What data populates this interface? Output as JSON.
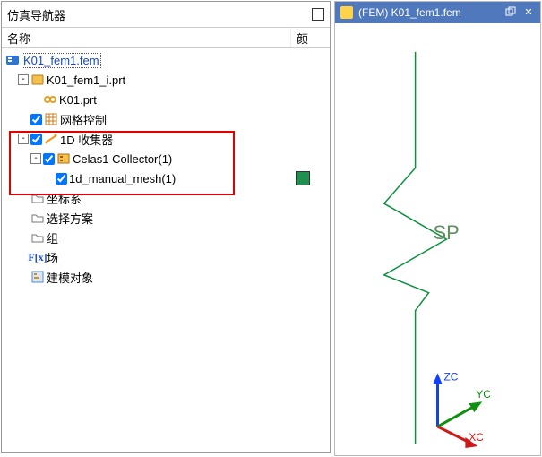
{
  "panelTitle": "仿真导航器",
  "colName": "名称",
  "colColor": "颜",
  "tree": {
    "root": "K01_fem1.fem",
    "prt_i": "K01_fem1_i.prt",
    "prt": "K01.prt",
    "meshCtrl": "网格控制",
    "collector1d": "1D 收集器",
    "celas": "Celas1 Collector(1)",
    "manual": "1d_manual_mesh(1)",
    "coord": "坐标系",
    "selScheme": "选择方案",
    "group": "组",
    "field": "场",
    "fieldPrefix": "F[x]",
    "modelObj": "建模对象"
  },
  "tab": {
    "title": "(FEM) K01_fem1.fem"
  },
  "axes": {
    "z": "ZC",
    "y": "YC",
    "x": "XC"
  },
  "spLabel": "SP"
}
